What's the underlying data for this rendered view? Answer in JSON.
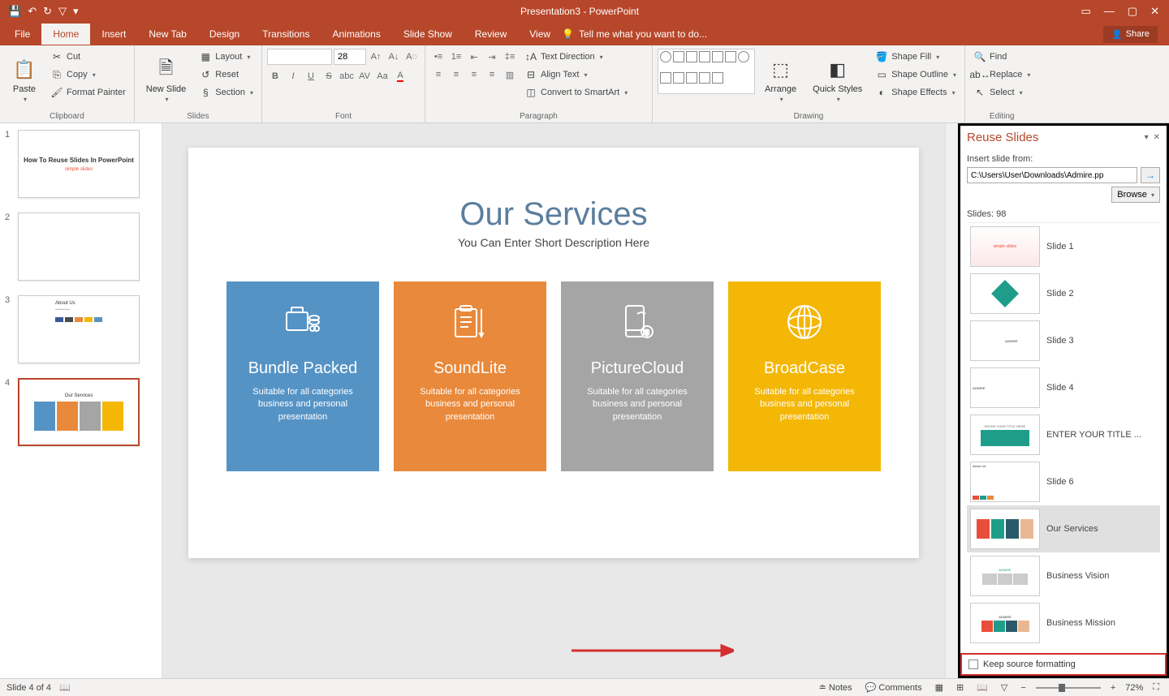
{
  "titlebar": {
    "title": "Presentation3 - PowerPoint"
  },
  "tabs": {
    "file": "File",
    "home": "Home",
    "insert": "Insert",
    "newtab": "New Tab",
    "design": "Design",
    "transitions": "Transitions",
    "animations": "Animations",
    "slideshow": "Slide Show",
    "review": "Review",
    "view": "View",
    "tellme": "Tell me what you want to do...",
    "share": "Share"
  },
  "ribbon": {
    "clipboard": {
      "label": "Clipboard",
      "paste": "Paste",
      "cut": "Cut",
      "copy": "Copy",
      "formatpainter": "Format Painter"
    },
    "slides": {
      "label": "Slides",
      "newslide": "New Slide",
      "layout": "Layout",
      "reset": "Reset",
      "section": "Section"
    },
    "font": {
      "label": "Font",
      "fontname": "",
      "fontsize": "28"
    },
    "paragraph": {
      "label": "Paragraph",
      "textdir": "Text Direction",
      "aligntext": "Align Text",
      "smartart": "Convert to SmartArt"
    },
    "drawing": {
      "label": "Drawing",
      "arrange": "Arrange",
      "quickstyles": "Quick Styles",
      "shapefill": "Shape Fill",
      "shapeoutline": "Shape Outline",
      "shapeeffects": "Shape Effects"
    },
    "editing": {
      "label": "Editing",
      "find": "Find",
      "replace": "Replace",
      "select": "Select"
    }
  },
  "thumbs": [
    {
      "num": "1",
      "title": "How To Reuse Slides In PowerPoint",
      "logo": "simple slides"
    },
    {
      "num": "2",
      "title": ""
    },
    {
      "num": "3",
      "title": "About Us"
    },
    {
      "num": "4",
      "title": "Our Services"
    }
  ],
  "slide": {
    "title": "Our Services",
    "subtitle": "You Can Enter Short Description Here",
    "cards": [
      {
        "title": "Bundle Packed",
        "desc": "Suitable for all categories business and personal presentation"
      },
      {
        "title": "SoundLite",
        "desc": "Suitable for all categories business and personal presentation"
      },
      {
        "title": "PictureCloud",
        "desc": "Suitable for all categories business and personal presentation"
      },
      {
        "title": "BroadCase",
        "desc": "Suitable for all categories business and personal presentation"
      }
    ]
  },
  "reuse": {
    "title": "Reuse Slides",
    "insertfrom": "Insert slide from:",
    "path": "C:\\Users\\User\\Downloads\\Admire.pp",
    "browse": "Browse",
    "count": "Slides: 98",
    "items": [
      {
        "name": "Slide 1"
      },
      {
        "name": "Slide 2"
      },
      {
        "name": "Slide 3"
      },
      {
        "name": "Slide 4"
      },
      {
        "name": "ENTER YOUR TITLE ..."
      },
      {
        "name": "Slide 6"
      },
      {
        "name": "Our Services"
      },
      {
        "name": "Business Vision"
      },
      {
        "name": "Business Mission"
      }
    ],
    "keepsource": "Keep source formatting"
  },
  "status": {
    "left": "Slide 4 of 4",
    "notes": "Notes",
    "comments": "Comments",
    "zoom": "72%"
  }
}
